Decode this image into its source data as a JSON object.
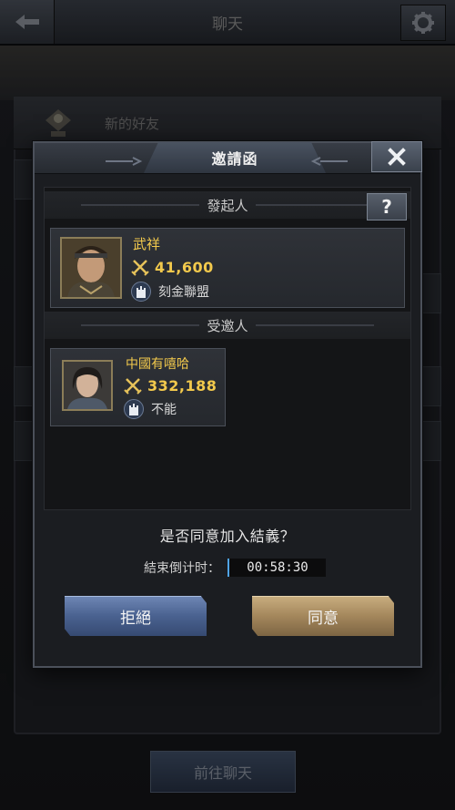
{
  "background": {
    "screen_title": "聊天",
    "friend_row_label": "新的好友",
    "bottom_button_label": "前往聊天"
  },
  "dialog": {
    "title": "邀請函",
    "close_icon": "close-x-icon",
    "sections": {
      "initiator_title": "發起人",
      "invitee_title": "受邀人"
    },
    "help_icon": "question-mark-icon",
    "initiator": {
      "name": "武祥",
      "power": "41,600",
      "alliance": "刻金聯盟"
    },
    "invitee": {
      "name": "中國有嘻哈",
      "power": "332,188",
      "alliance": "不能"
    },
    "question": "是否同意加入結義？",
    "countdown": {
      "label": "結束倒计时：",
      "value": "00:58:30"
    },
    "buttons": {
      "reject": "拒絕",
      "accept": "同意"
    }
  },
  "colors": {
    "gold_text": "#f2c94c",
    "reject_button": "#4a6290",
    "accept_button": "#a4875c",
    "countdown_accent": "#4fa3e6"
  }
}
